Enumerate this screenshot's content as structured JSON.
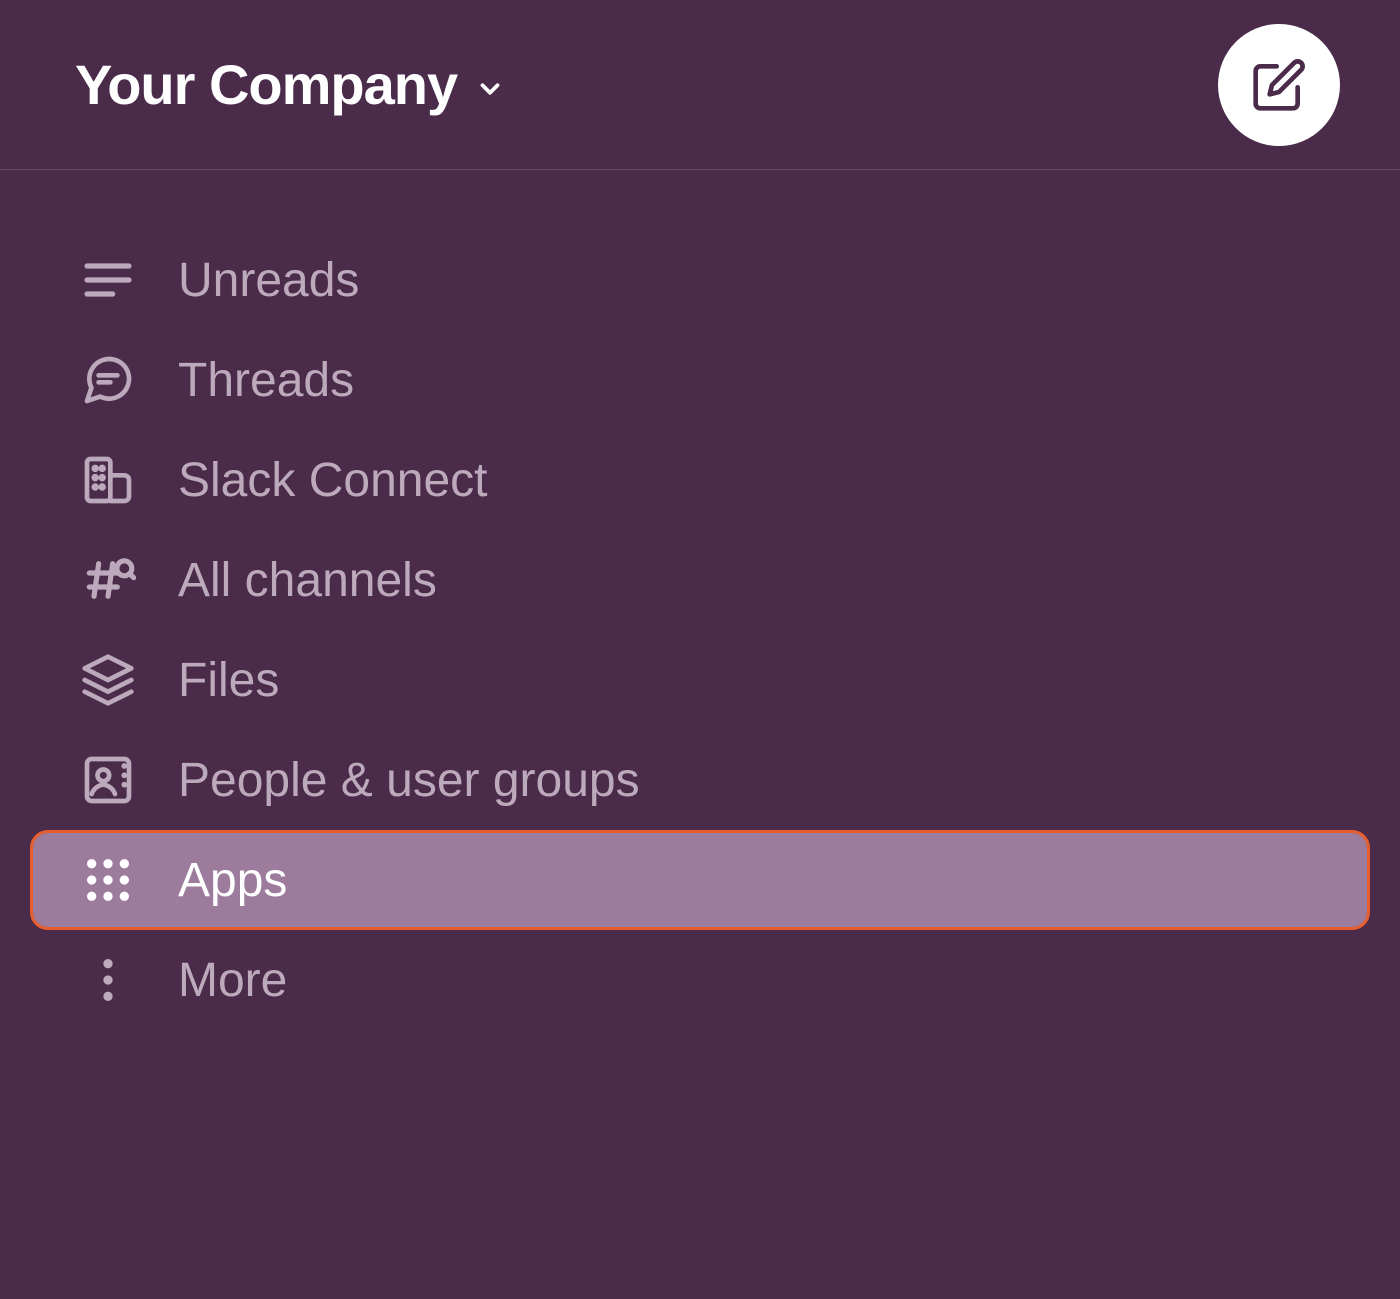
{
  "header": {
    "workspace_name": "Your Company"
  },
  "sidebar": {
    "items": [
      {
        "label": "Unreads",
        "icon": "unreads-icon",
        "selected": false
      },
      {
        "label": "Threads",
        "icon": "threads-icon",
        "selected": false
      },
      {
        "label": "Slack Connect",
        "icon": "slack-connect-icon",
        "selected": false
      },
      {
        "label": "All channels",
        "icon": "all-channels-icon",
        "selected": false
      },
      {
        "label": "Files",
        "icon": "files-icon",
        "selected": false
      },
      {
        "label": "People & user groups",
        "icon": "people-icon",
        "selected": false
      },
      {
        "label": "Apps",
        "icon": "apps-icon",
        "selected": true
      },
      {
        "label": "More",
        "icon": "more-icon",
        "selected": false
      }
    ]
  },
  "colors": {
    "sidebar_bg": "#4a2b4a",
    "text_muted": "#bda9bc",
    "text_white": "#ffffff",
    "selected_bg": "#9c7b9c",
    "highlight_border": "#e85d2c"
  }
}
